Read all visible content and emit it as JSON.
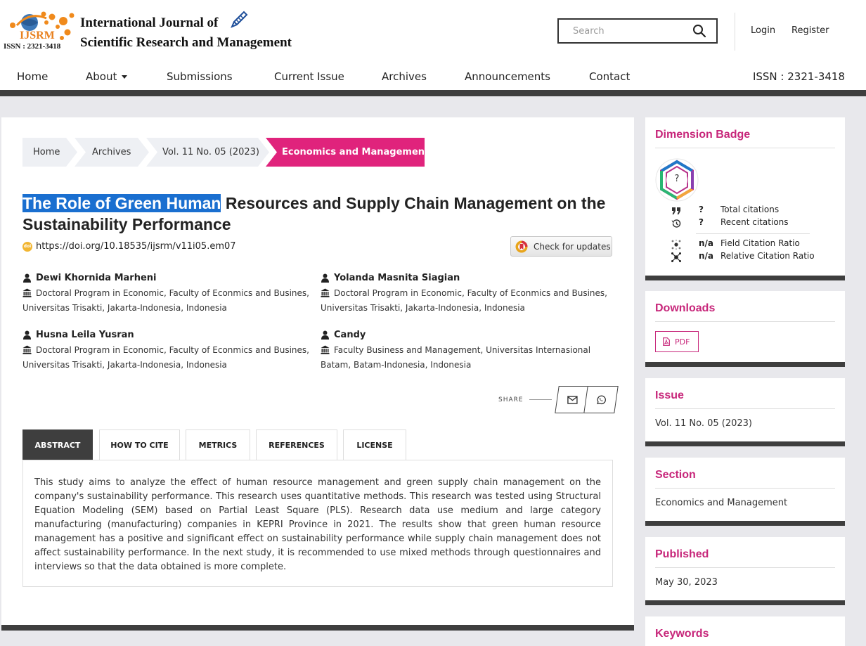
{
  "header": {
    "logo": {
      "abbr": "IJSRM",
      "issn": "ISSN : 2321-3418",
      "title_line1": "International Journal of",
      "title_line2": "Scientific Research and Management"
    },
    "search": {
      "placeholder": "Search"
    },
    "login_label": "Login",
    "register_label": "Register"
  },
  "nav": {
    "items": [
      "Home",
      "About",
      "Submissions",
      "Current Issue",
      "Archives",
      "Announcements",
      "Contact"
    ],
    "issn": "ISSN : 2321-3418"
  },
  "breadcrumb": [
    "Home",
    "Archives",
    "Vol. 11 No. 05 (2023)",
    "Economics and Management"
  ],
  "article": {
    "title_highlight": "The Role of Green Human",
    "title_rest": " Resources and Supply Chain Management on the Sustainability Performance",
    "doi_url": "https://doi.org/10.18535/ijsrm/v11i05.em07",
    "doi_badge": "doi",
    "check_updates_label": "Check for updates",
    "authors": [
      {
        "name": "Dewi Khornida Marheni",
        "affiliation": "Doctoral Program in Economic, Faculty of Econmics and Busines, Universitas Trisakti, Jakarta-Indonesia, Indonesia"
      },
      {
        "name": "Yolanda Masnita Siagian",
        "affiliation": "Doctoral Program in Economic, Faculty of Econmics and Busines, Universitas Trisakti, Jakarta-Indonesia, Indonesia"
      },
      {
        "name": "Husna Leila Yusran",
        "affiliation": "Doctoral Program in Economic, Faculty of Econmics and Busines, Universitas Trisakti, Jakarta-Indonesia, Indonesia"
      },
      {
        "name": "Candy",
        "affiliation": "Faculty Business and Management, Universitas Internasional Batam, Batam-Indonesia, Indonesia"
      }
    ],
    "share_label": "SHARE",
    "tabs": [
      "ABSTRACT",
      "HOW TO CITE",
      "METRICS",
      "REFERENCES",
      "LICENSE"
    ],
    "active_tab": "ABSTRACT",
    "abstract": "This study aims to analyze the effect of human resource management and green supply chain management on the company's sustainability performance. This research uses quantitative methods. This research was tested using Structural Equation Modeling (SEM) based on Partial Least Square (PLS). Research data use medium and large category manufacturing (manufacturing) companies in KEPRI Province in 2021. The results show that green human resource management has a positive and significant effect on sustainability performance while supply chain management does not affect sustainability performance. In the next study, it is recommended to use mixed methods through questionnaires and interviews so that the data obtained is more complete."
  },
  "sidebar": {
    "dimension": {
      "title": "Dimension Badge",
      "badge_value": "?",
      "metrics": [
        {
          "icon": "quote-icon",
          "value": "?",
          "label": "Total citations"
        },
        {
          "icon": "history-icon",
          "value": "?",
          "label": "Recent citations"
        },
        {
          "icon": "field-ratio-icon",
          "value": "n/a",
          "label": "Field Citation Ratio"
        },
        {
          "icon": "relative-ratio-icon",
          "value": "n/a",
          "label": "Relative Citation Ratio"
        }
      ]
    },
    "downloads": {
      "title": "Downloads",
      "pdf_label": "PDF"
    },
    "issue": {
      "title": "Issue",
      "value": "Vol. 11 No. 05 (2023)"
    },
    "section": {
      "title": "Section",
      "value": "Economics and Management"
    },
    "published": {
      "title": "Published",
      "value": "May 30, 2023"
    },
    "keywords": {
      "title": "Keywords"
    }
  },
  "colors": {
    "accent_magenta": "#c7267a",
    "breadcrumb_active": "#e0237c",
    "dark_bar": "#3e3e3e",
    "selection_blue": "#1a6fd0",
    "page_background": "#e8e8ec"
  }
}
